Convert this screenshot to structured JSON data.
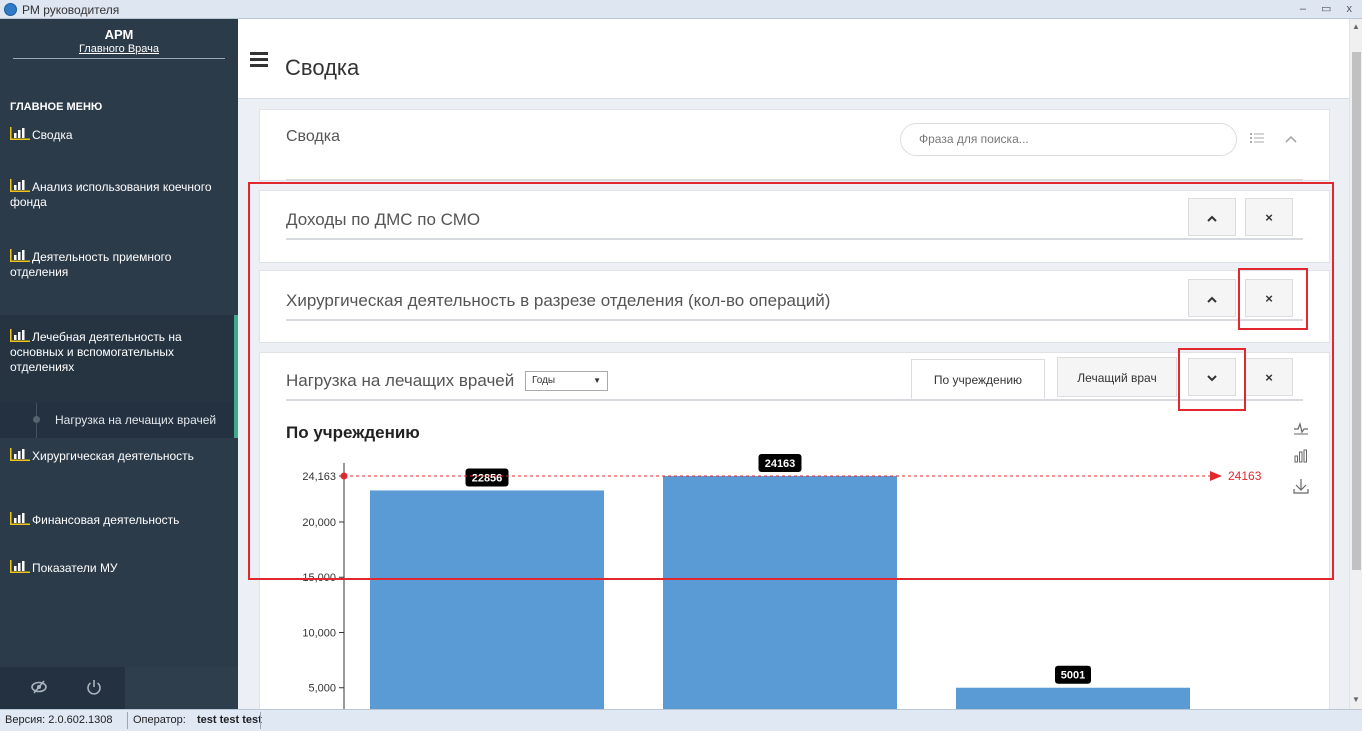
{
  "window": {
    "title": "РМ руководителя",
    "controls": "– ▭ x"
  },
  "sidebar": {
    "brand_line1": "АРМ",
    "brand_line2": "Главного Врача",
    "menu_header": "ГЛАВНОЕ МЕНЮ",
    "items": [
      {
        "label": "Сводка"
      },
      {
        "label": "Анализ использования коечного фонда"
      },
      {
        "label": "Деятельность приемного отделения"
      },
      {
        "label": "Лечебная деятельность на основных и вспомогательных отделениях"
      },
      {
        "label": "Хирургическая деятельность"
      },
      {
        "label": "Финансовая деятельность"
      },
      {
        "label": "Показатели МУ"
      }
    ],
    "sub_item": "Нагрузка на лечащих врачей",
    "bottom_icons": [
      "eye-slash-icon",
      "power-icon"
    ]
  },
  "header": {
    "title": "Сводка"
  },
  "summary_box": {
    "title": "Сводка",
    "search_placeholder": "Фраза для поиска..."
  },
  "widgets": [
    {
      "title": "Доходы по ДМС по СМО",
      "collapse": "^",
      "close": "×"
    },
    {
      "title": "Хирургическая деятельность в разрезе отделения (кол-во операций)",
      "collapse": "^",
      "close": "×"
    }
  ],
  "load_widget": {
    "title": "Нагрузка на лечащих врачей",
    "period_select": "Годы",
    "tabs": [
      "По учреждению",
      "Лечащий врач"
    ],
    "active_tab": 0,
    "expand": "⌄",
    "close": "×"
  },
  "chart_data": {
    "type": "bar",
    "title": "По учреждению",
    "categories": [
      "",
      "",
      ""
    ],
    "values": [
      22856,
      24163,
      5001
    ],
    "y_ticks": [
      "24,163",
      "20,000",
      "15,000",
      "10,000",
      "5,000"
    ],
    "max_line_label": "24163",
    "bar_color": "#5b9bd5",
    "max_line_color": "#e0282e"
  },
  "statusbar": {
    "version": "Версия: 2.0.602.1308",
    "operator_label": "Оператор:",
    "operator_name": "test test test"
  }
}
